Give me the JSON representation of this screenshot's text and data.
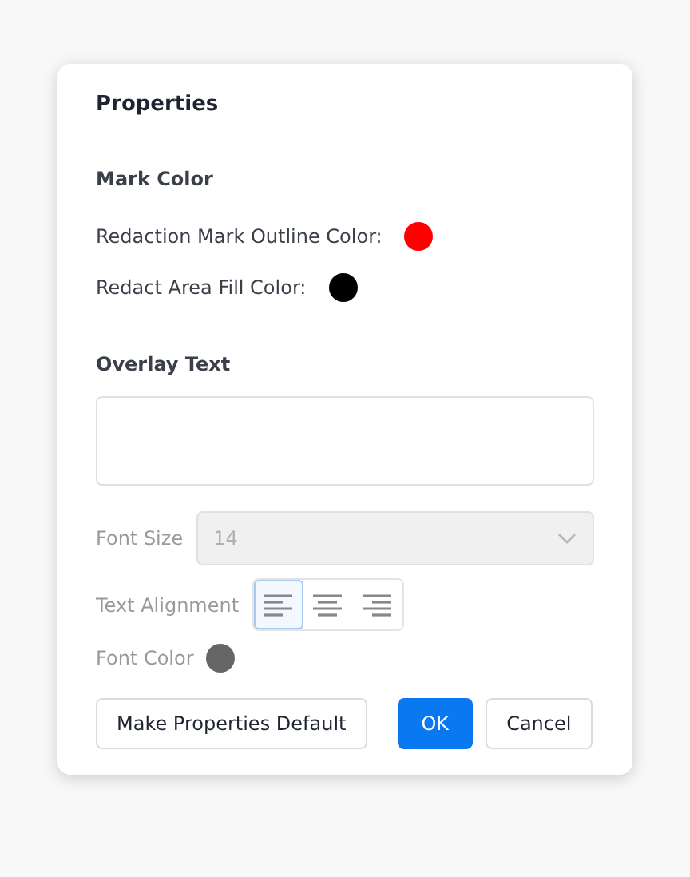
{
  "dialog": {
    "title": "Properties",
    "mark_color": {
      "heading": "Mark Color",
      "items": [
        {
          "label": "Redaction Mark Outline Color:",
          "color": "#ff0000"
        },
        {
          "label": "Redact Area Fill Color:",
          "color": "#000000"
        }
      ]
    },
    "overlay_text": {
      "heading": "Overlay Text",
      "font_size": {
        "label": "Font Size",
        "value": "14",
        "disabled": true
      },
      "text_alignment": {
        "label": "Text Alignment",
        "disabled": true,
        "options": [
          {
            "kind": "left",
            "selected": true
          },
          {
            "kind": "center",
            "selected": false
          },
          {
            "kind": "right",
            "selected": false
          }
        ]
      },
      "font_color": {
        "label": "Font Color",
        "color": "#666666",
        "disabled": true
      }
    },
    "buttons": [
      {
        "label": "Make Properties Default",
        "kind": "secondary"
      },
      {
        "label": "OK",
        "kind": "primary"
      },
      {
        "label": "Cancel",
        "kind": "secondary"
      }
    ]
  }
}
